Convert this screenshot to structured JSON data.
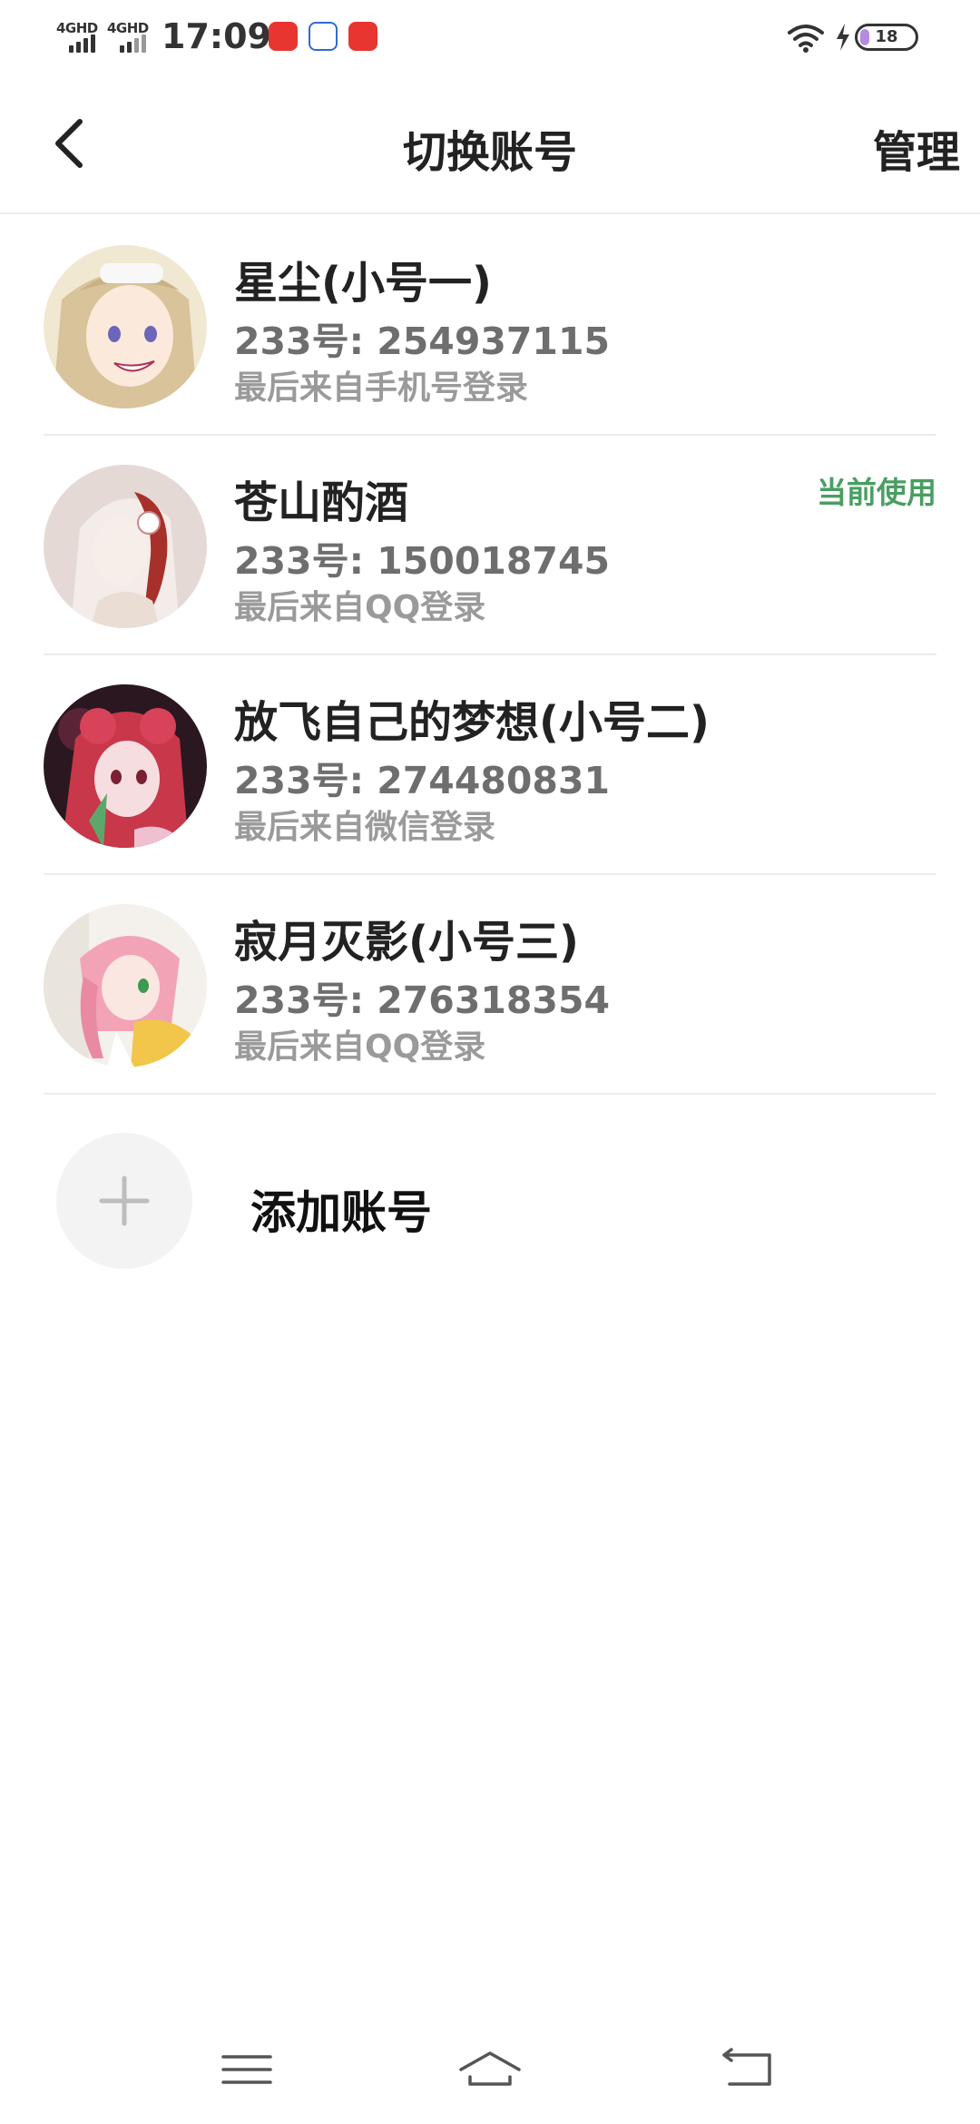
{
  "status_bar": {
    "signal_1": "4GHD",
    "signal_2": "4GHD",
    "time": "17:09",
    "battery": "18",
    "colors": {
      "battery_fill": "#b58be0"
    }
  },
  "header": {
    "title": "切换账号",
    "manage_label": "管理"
  },
  "accounts": [
    {
      "name": "星尘(小号一)",
      "id_line": "233号: 254937115",
      "login_line": "最后来自手机号登录",
      "current": ""
    },
    {
      "name": "苍山酌酒",
      "id_line": "233号: 150018745",
      "login_line": "最后来自QQ登录",
      "current": "当前使用"
    },
    {
      "name": "放飞自己的梦想(小号二)",
      "id_line": "233号: 274480831",
      "login_line": "最后来自微信登录",
      "current": ""
    },
    {
      "name": "寂月灭影(小号三)",
      "id_line": "233号: 276318354",
      "login_line": "最后来自QQ登录",
      "current": ""
    }
  ],
  "add_account": {
    "label": "添加账号",
    "icon": "plus-icon"
  },
  "colors": {
    "current_tag": "#4a9e62",
    "divider": "#ececec"
  },
  "nav_bar": {
    "icons": [
      "menu-icon",
      "home-icon",
      "back-icon"
    ]
  }
}
